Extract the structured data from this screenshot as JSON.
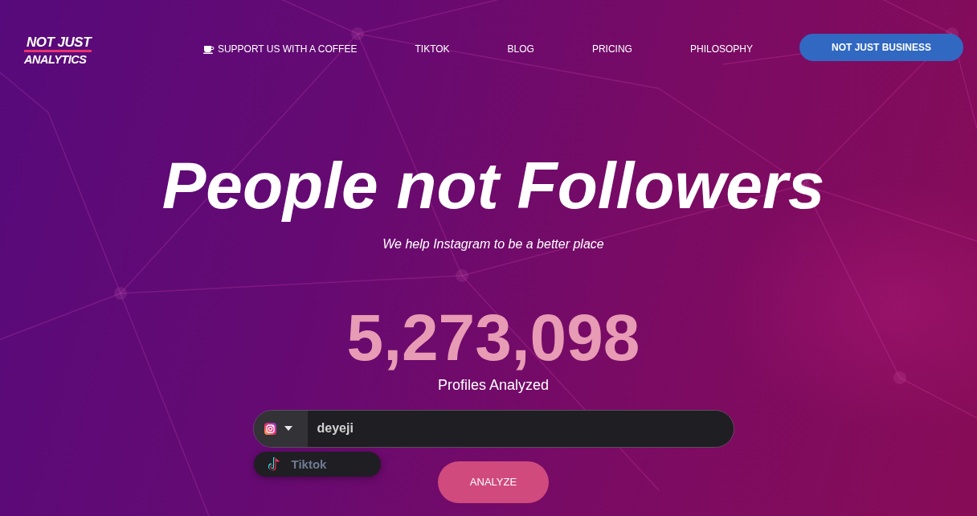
{
  "header": {
    "logo": {
      "lines": [
        "NOT JUST",
        "ANALYTICS"
      ]
    },
    "nav": [
      {
        "label": "SUPPORT US WITH A COFFEE",
        "kind": "coffee"
      },
      {
        "label": "TIKTOK",
        "kind": "plain"
      },
      {
        "label": "BLOG",
        "kind": "plain"
      },
      {
        "label": "PRICING",
        "kind": "plain"
      },
      {
        "label": "PHILOSOPHY",
        "kind": "plain"
      }
    ],
    "cta_button": "NOT JUST BUSINESS"
  },
  "hero": {
    "title": "People not Followers",
    "subtitle": "We help Instagram to be a better place",
    "counter": "5,273,098",
    "counter_label": "Profiles Analyzed"
  },
  "search": {
    "platform_select": {
      "expanded": true,
      "options": [
        {
          "label": "Tiktok",
          "selected": false
        }
      ]
    },
    "value": "deyeji",
    "button": "ANALYZE"
  }
}
